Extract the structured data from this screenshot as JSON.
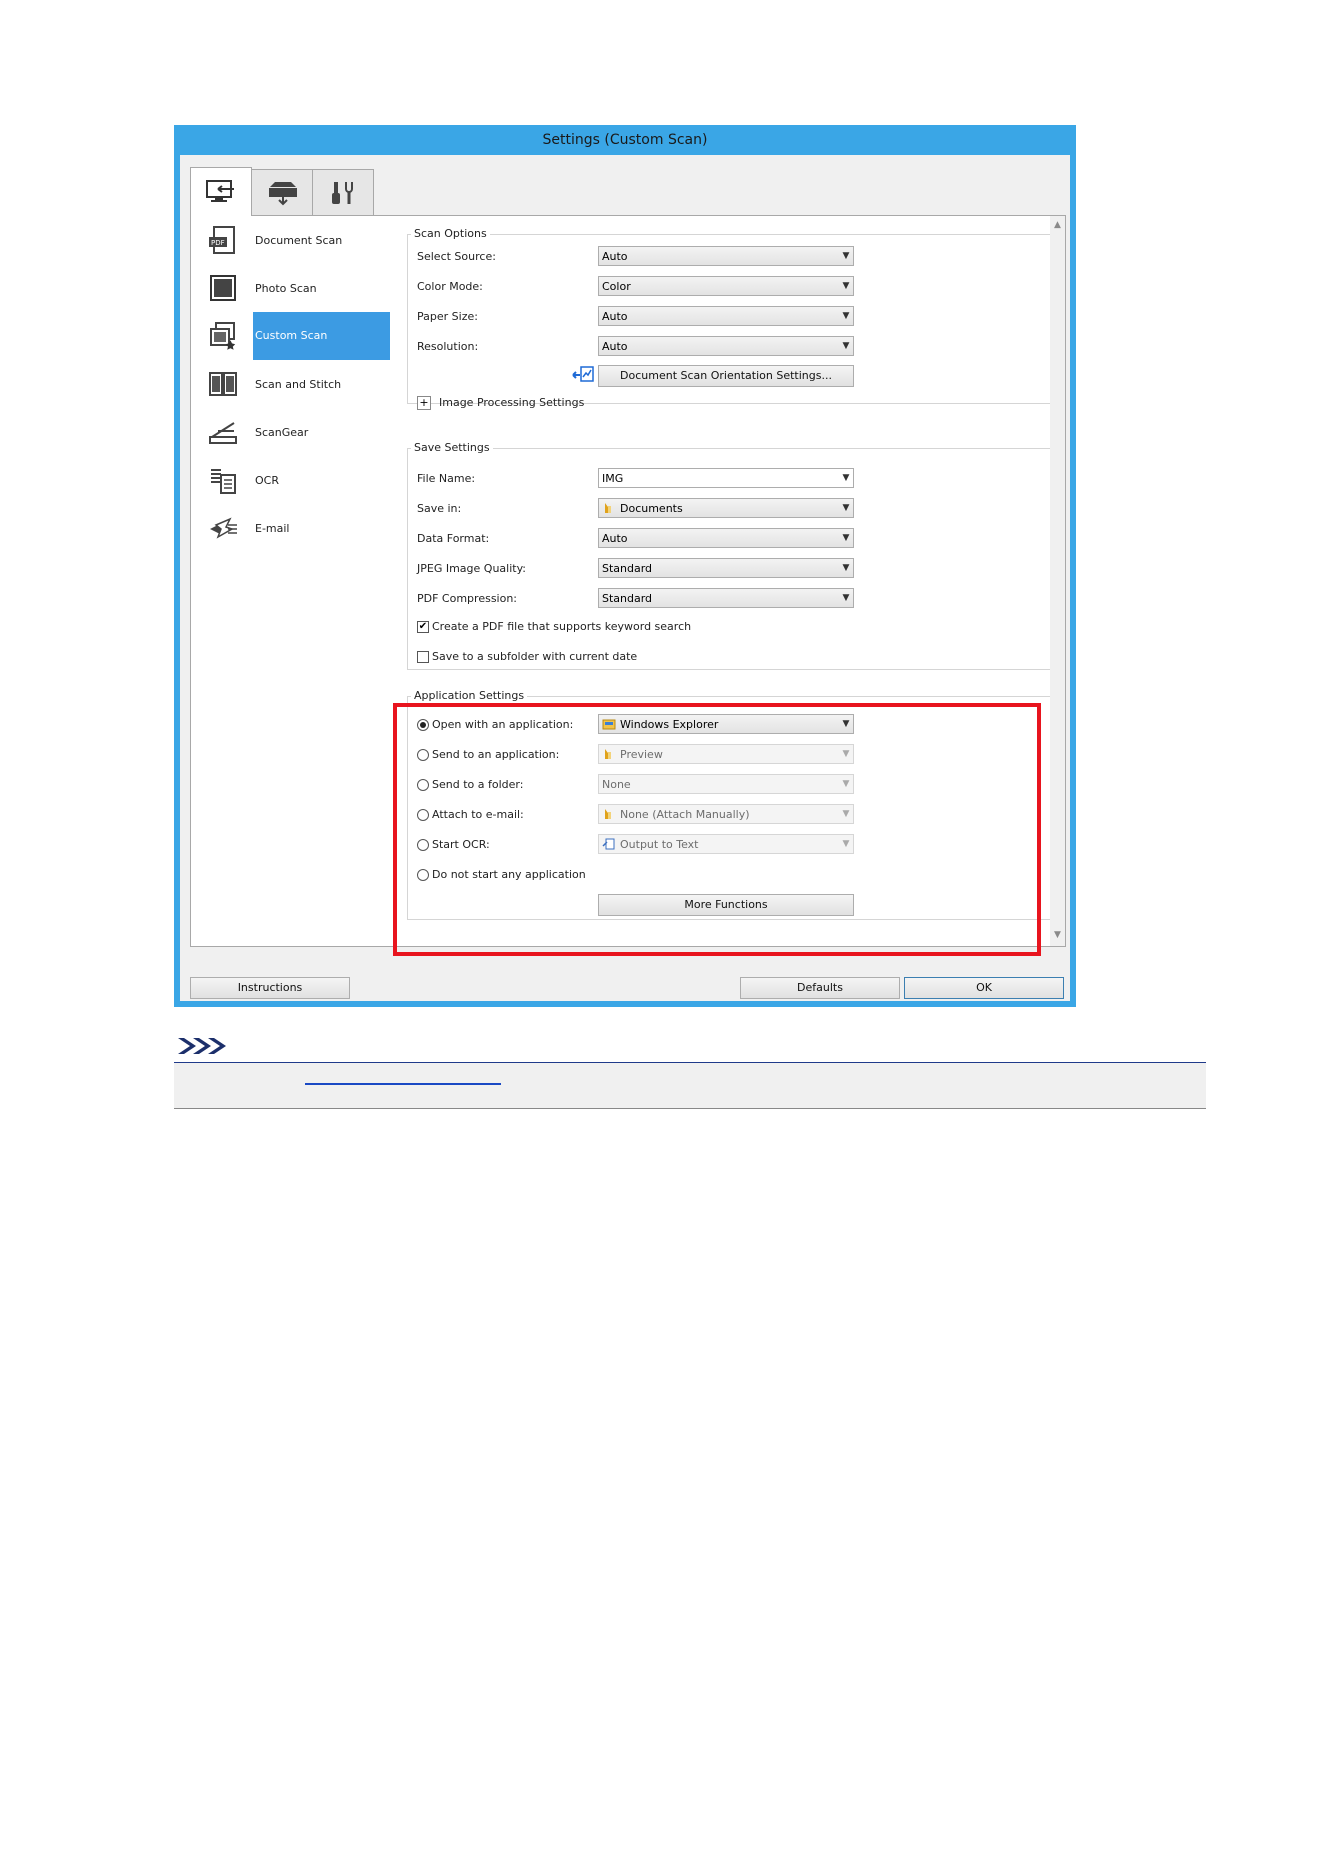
{
  "window": {
    "title": "Settings (Custom Scan)",
    "accent_color": "#3aa6e6"
  },
  "tabs": [
    {
      "icon": "scan-from-computer-icon",
      "active": true
    },
    {
      "icon": "scan-from-panel-icon",
      "active": false
    },
    {
      "icon": "general-settings-icon",
      "active": false
    }
  ],
  "sidebar": {
    "items": [
      {
        "label": "Document Scan",
        "icon": "pdf-document-icon"
      },
      {
        "label": "Photo Scan",
        "icon": "photo-icon"
      },
      {
        "label": "Custom Scan",
        "icon": "custom-scan-icon",
        "selected": true
      },
      {
        "label": "Scan and Stitch",
        "icon": "stitch-icon"
      },
      {
        "label": "ScanGear",
        "icon": "scanner-icon"
      },
      {
        "label": "OCR",
        "icon": "ocr-icon"
      },
      {
        "label": "E-mail",
        "icon": "email-icon"
      }
    ],
    "selected_color": "#3c9be3"
  },
  "scan_options": {
    "title": "Scan Options",
    "select_source": {
      "label": "Select Source:",
      "value": "Auto"
    },
    "color_mode": {
      "label": "Color Mode:",
      "value": "Color"
    },
    "paper_size": {
      "label": "Paper Size:",
      "value": "Auto"
    },
    "resolution": {
      "label": "Resolution:",
      "value": "Auto"
    },
    "orientation_button": "Document Scan Orientation Settings...",
    "image_processing": "Image Processing Settings",
    "expand_symbol": "+"
  },
  "save_settings": {
    "title": "Save Settings",
    "file_name": {
      "label": "File Name:",
      "value": "IMG"
    },
    "save_in": {
      "label": "Save in:",
      "value": "Documents"
    },
    "data_format": {
      "label": "Data Format:",
      "value": "Auto"
    },
    "jpeg_quality": {
      "label": "JPEG Image Quality:",
      "value": "Standard"
    },
    "pdf_compression": {
      "label": "PDF Compression:",
      "value": "Standard"
    },
    "keyword_search": {
      "label": "Create a PDF file that supports keyword search",
      "checked": true
    },
    "subfolder": {
      "label": "Save to a subfolder with current date",
      "checked": false
    }
  },
  "application_settings": {
    "title": "Application Settings",
    "open_with": {
      "label": "Open with an application:",
      "value": "Windows Explorer",
      "selected": true
    },
    "send_to_app": {
      "label": "Send to an application:",
      "value": "Preview"
    },
    "send_to_folder": {
      "label": "Send to a folder:",
      "value": "None"
    },
    "attach_email": {
      "label": "Attach to e-mail:",
      "value": "None (Attach Manually)"
    },
    "start_ocr": {
      "label": "Start OCR:",
      "value": "Output to Text"
    },
    "no_app": {
      "label": "Do not start any application"
    },
    "more_functions": "More Functions",
    "highlight_color": "#e8141e"
  },
  "footer": {
    "instructions": "Instructions",
    "defaults": "Defaults",
    "ok": "OK"
  },
  "glyphs": {
    "dropdown_arrow": "▼",
    "check_mark": "✔",
    "scroll_up": "▲",
    "scroll_down": "▼"
  }
}
